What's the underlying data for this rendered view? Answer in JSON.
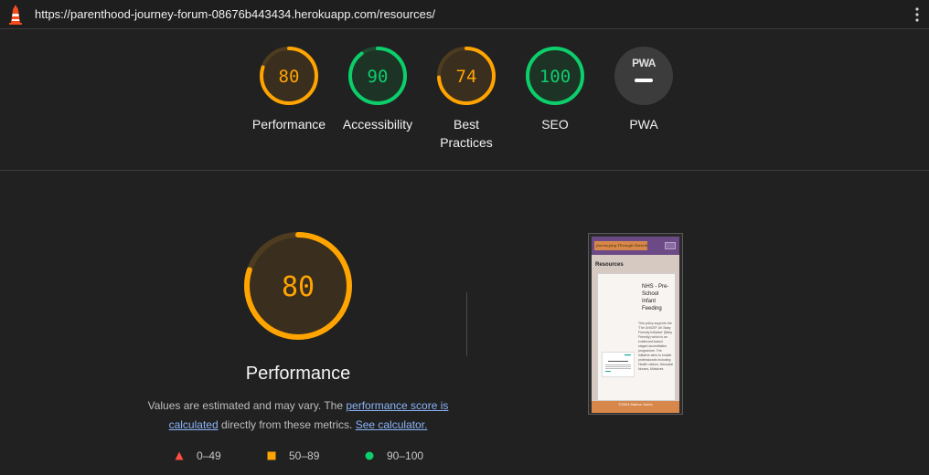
{
  "browser": {
    "url": "https://parenthood-journey-forum-08676b443434.herokuapp.com/resources/"
  },
  "colors": {
    "pass": "#0cce6b",
    "average": "#ffa400",
    "fail": "#ff4e42",
    "pwa_bg": "#3c3c3c"
  },
  "gauges": [
    {
      "score": "80",
      "label": "Performance",
      "status": "average"
    },
    {
      "score": "90",
      "label": "Accessibility",
      "status": "pass"
    },
    {
      "score": "74",
      "label_line1": "Best",
      "label_line2": "Practices",
      "status": "average"
    },
    {
      "score": "100",
      "label": "SEO",
      "status": "pass"
    },
    {
      "badge": "PWA",
      "label": "PWA",
      "icon": "pwa-badge-icon"
    }
  ],
  "performance": {
    "score": "80",
    "title": "Performance",
    "desc_prefix": "Values are estimated and may vary. The ",
    "desc_link1": "performance score is calculated",
    "desc_middle": " directly from these metrics. ",
    "desc_link2": "See calculator."
  },
  "legend": [
    {
      "range": "0–49",
      "icon": "triangle-icon"
    },
    {
      "range": "50–89",
      "icon": "square-icon"
    },
    {
      "range": "90–100",
      "icon": "circle-icon"
    }
  ],
  "screenshot": {
    "brand": "Journeying Through Parenthood",
    "heading": "Resources",
    "card_title": "NHS - Pre-School Infant Feeding",
    "card_text": "This policy supports the 'The UNICEF UK Baby Friendly Initiative' (Baby Friendly) which is an evidenced-based staged accreditation programme. The initiative aims to enable professionals including Health visitors, Neonatal Nurses, Midwives",
    "footer": "©2024 Marina Jones"
  }
}
